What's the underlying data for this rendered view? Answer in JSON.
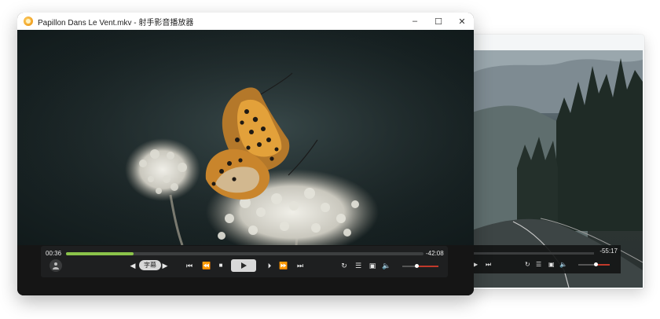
{
  "main_window": {
    "title": "Papillon Dans Le Vent.mkv - 射手影音播放器",
    "window_buttons": {
      "minimize": "–",
      "maximize": "☐",
      "close": "✕"
    },
    "player": {
      "elapsed": "00:36",
      "remaining": "-42:08",
      "progress_fraction": 0.19,
      "subtitle_label": "字幕",
      "volume_fraction": 0.4
    }
  },
  "back_window": {
    "remaining": "-55:17"
  },
  "icons": {
    "app": "splayer-logo-icon",
    "prev": "skip-previous-icon",
    "rewind": "rewind-icon",
    "stop": "stop-icon",
    "play": "play-icon",
    "frame": "frame-step-icon",
    "forward": "fast-forward-icon",
    "next": "skip-next-icon",
    "rotate": "rotate-icon",
    "playlist": "playlist-icon",
    "snapshot": "screenshot-icon",
    "volume": "volume-icon"
  },
  "colors": {
    "progress": "#8bc34a",
    "volume": "#c0392b"
  }
}
